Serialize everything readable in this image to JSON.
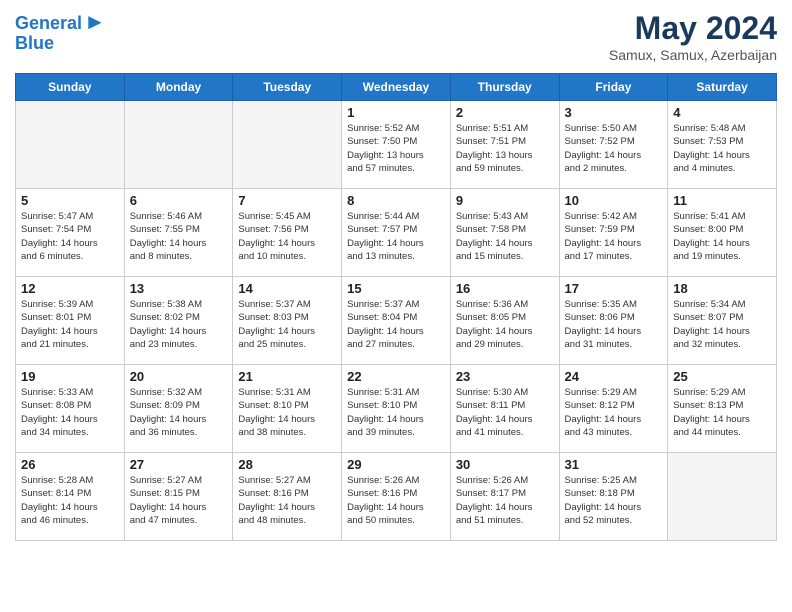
{
  "header": {
    "logo_line1": "General",
    "logo_line2": "Blue",
    "title": "May 2024",
    "location": "Samux, Samux, Azerbaijan"
  },
  "weekdays": [
    "Sunday",
    "Monday",
    "Tuesday",
    "Wednesday",
    "Thursday",
    "Friday",
    "Saturday"
  ],
  "weeks": [
    [
      {
        "day": "",
        "info": "",
        "empty": true
      },
      {
        "day": "",
        "info": "",
        "empty": true
      },
      {
        "day": "",
        "info": "",
        "empty": true
      },
      {
        "day": "1",
        "info": "Sunrise: 5:52 AM\nSunset: 7:50 PM\nDaylight: 13 hours\nand 57 minutes.",
        "empty": false
      },
      {
        "day": "2",
        "info": "Sunrise: 5:51 AM\nSunset: 7:51 PM\nDaylight: 13 hours\nand 59 minutes.",
        "empty": false
      },
      {
        "day": "3",
        "info": "Sunrise: 5:50 AM\nSunset: 7:52 PM\nDaylight: 14 hours\nand 2 minutes.",
        "empty": false
      },
      {
        "day": "4",
        "info": "Sunrise: 5:48 AM\nSunset: 7:53 PM\nDaylight: 14 hours\nand 4 minutes.",
        "empty": false
      }
    ],
    [
      {
        "day": "5",
        "info": "Sunrise: 5:47 AM\nSunset: 7:54 PM\nDaylight: 14 hours\nand 6 minutes.",
        "empty": false
      },
      {
        "day": "6",
        "info": "Sunrise: 5:46 AM\nSunset: 7:55 PM\nDaylight: 14 hours\nand 8 minutes.",
        "empty": false
      },
      {
        "day": "7",
        "info": "Sunrise: 5:45 AM\nSunset: 7:56 PM\nDaylight: 14 hours\nand 10 minutes.",
        "empty": false
      },
      {
        "day": "8",
        "info": "Sunrise: 5:44 AM\nSunset: 7:57 PM\nDaylight: 14 hours\nand 13 minutes.",
        "empty": false
      },
      {
        "day": "9",
        "info": "Sunrise: 5:43 AM\nSunset: 7:58 PM\nDaylight: 14 hours\nand 15 minutes.",
        "empty": false
      },
      {
        "day": "10",
        "info": "Sunrise: 5:42 AM\nSunset: 7:59 PM\nDaylight: 14 hours\nand 17 minutes.",
        "empty": false
      },
      {
        "day": "11",
        "info": "Sunrise: 5:41 AM\nSunset: 8:00 PM\nDaylight: 14 hours\nand 19 minutes.",
        "empty": false
      }
    ],
    [
      {
        "day": "12",
        "info": "Sunrise: 5:39 AM\nSunset: 8:01 PM\nDaylight: 14 hours\nand 21 minutes.",
        "empty": false
      },
      {
        "day": "13",
        "info": "Sunrise: 5:38 AM\nSunset: 8:02 PM\nDaylight: 14 hours\nand 23 minutes.",
        "empty": false
      },
      {
        "day": "14",
        "info": "Sunrise: 5:37 AM\nSunset: 8:03 PM\nDaylight: 14 hours\nand 25 minutes.",
        "empty": false
      },
      {
        "day": "15",
        "info": "Sunrise: 5:37 AM\nSunset: 8:04 PM\nDaylight: 14 hours\nand 27 minutes.",
        "empty": false
      },
      {
        "day": "16",
        "info": "Sunrise: 5:36 AM\nSunset: 8:05 PM\nDaylight: 14 hours\nand 29 minutes.",
        "empty": false
      },
      {
        "day": "17",
        "info": "Sunrise: 5:35 AM\nSunset: 8:06 PM\nDaylight: 14 hours\nand 31 minutes.",
        "empty": false
      },
      {
        "day": "18",
        "info": "Sunrise: 5:34 AM\nSunset: 8:07 PM\nDaylight: 14 hours\nand 32 minutes.",
        "empty": false
      }
    ],
    [
      {
        "day": "19",
        "info": "Sunrise: 5:33 AM\nSunset: 8:08 PM\nDaylight: 14 hours\nand 34 minutes.",
        "empty": false
      },
      {
        "day": "20",
        "info": "Sunrise: 5:32 AM\nSunset: 8:09 PM\nDaylight: 14 hours\nand 36 minutes.",
        "empty": false
      },
      {
        "day": "21",
        "info": "Sunrise: 5:31 AM\nSunset: 8:10 PM\nDaylight: 14 hours\nand 38 minutes.",
        "empty": false
      },
      {
        "day": "22",
        "info": "Sunrise: 5:31 AM\nSunset: 8:10 PM\nDaylight: 14 hours\nand 39 minutes.",
        "empty": false
      },
      {
        "day": "23",
        "info": "Sunrise: 5:30 AM\nSunset: 8:11 PM\nDaylight: 14 hours\nand 41 minutes.",
        "empty": false
      },
      {
        "day": "24",
        "info": "Sunrise: 5:29 AM\nSunset: 8:12 PM\nDaylight: 14 hours\nand 43 minutes.",
        "empty": false
      },
      {
        "day": "25",
        "info": "Sunrise: 5:29 AM\nSunset: 8:13 PM\nDaylight: 14 hours\nand 44 minutes.",
        "empty": false
      }
    ],
    [
      {
        "day": "26",
        "info": "Sunrise: 5:28 AM\nSunset: 8:14 PM\nDaylight: 14 hours\nand 46 minutes.",
        "empty": false
      },
      {
        "day": "27",
        "info": "Sunrise: 5:27 AM\nSunset: 8:15 PM\nDaylight: 14 hours\nand 47 minutes.",
        "empty": false
      },
      {
        "day": "28",
        "info": "Sunrise: 5:27 AM\nSunset: 8:16 PM\nDaylight: 14 hours\nand 48 minutes.",
        "empty": false
      },
      {
        "day": "29",
        "info": "Sunrise: 5:26 AM\nSunset: 8:16 PM\nDaylight: 14 hours\nand 50 minutes.",
        "empty": false
      },
      {
        "day": "30",
        "info": "Sunrise: 5:26 AM\nSunset: 8:17 PM\nDaylight: 14 hours\nand 51 minutes.",
        "empty": false
      },
      {
        "day": "31",
        "info": "Sunrise: 5:25 AM\nSunset: 8:18 PM\nDaylight: 14 hours\nand 52 minutes.",
        "empty": false
      },
      {
        "day": "",
        "info": "",
        "empty": true
      }
    ]
  ]
}
